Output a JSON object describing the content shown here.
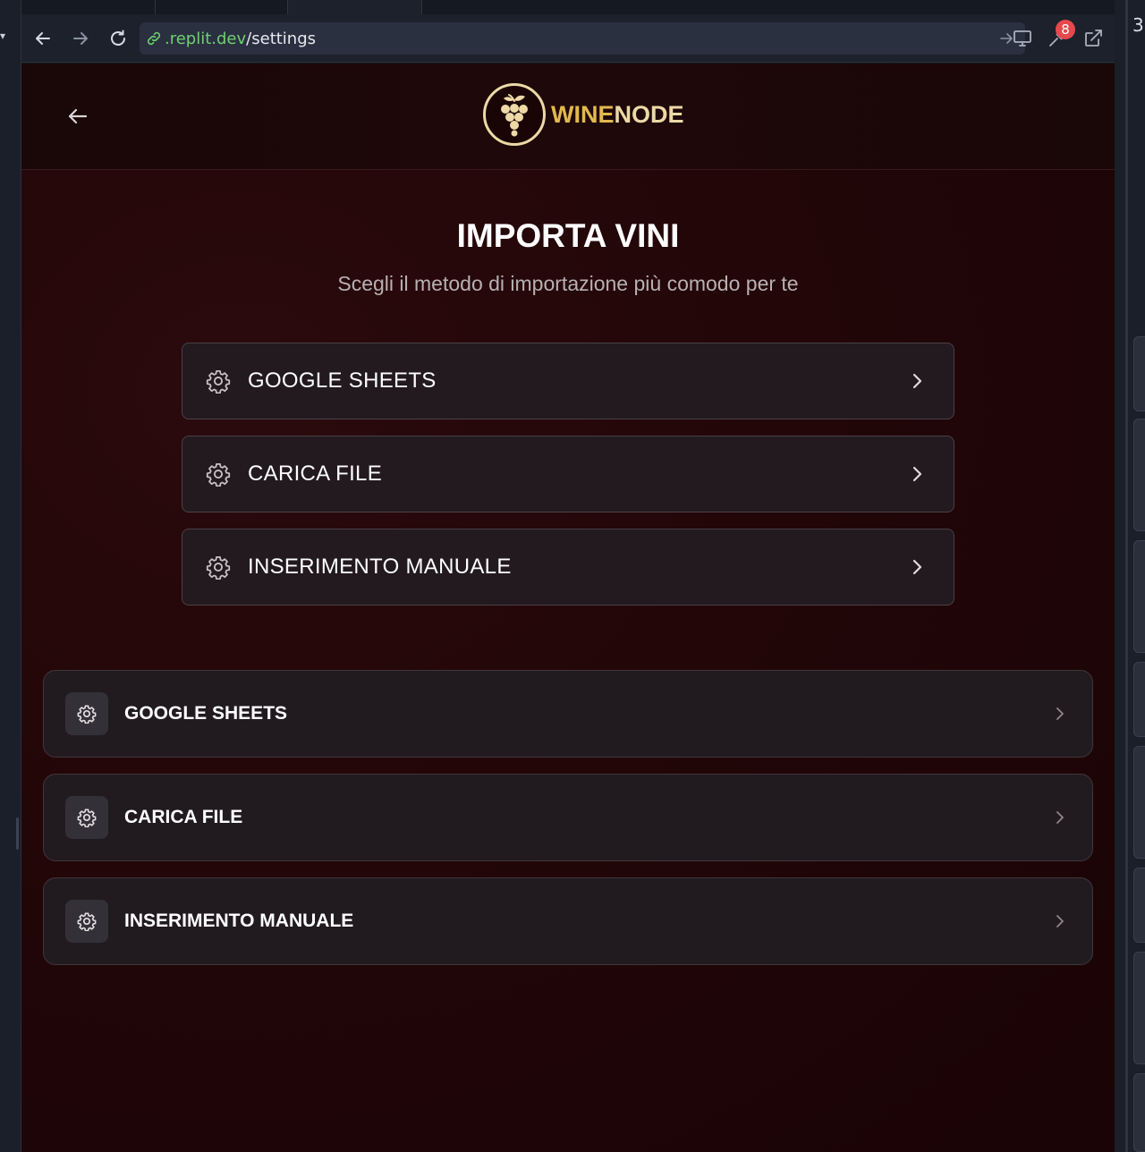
{
  "browser": {
    "url_domain": ".replit.dev",
    "url_path": "/settings",
    "notification_count": "8"
  },
  "side": {
    "right_number": "3"
  },
  "app": {
    "logo": {
      "part1": "WINE",
      "part2": "NODE"
    },
    "title": "IMPORTA VINI",
    "subtitle": "Scegli il metodo di importazione più comodo per te",
    "options_primary": [
      {
        "label": "GOOGLE SHEETS"
      },
      {
        "label": "CARICA FILE"
      },
      {
        "label": "INSERIMENTO MANUALE"
      }
    ],
    "options_secondary": [
      {
        "label": "GOOGLE SHEETS"
      },
      {
        "label": "CARICA FILE"
      },
      {
        "label": "INSERIMENTO MANUALE"
      }
    ]
  },
  "colors": {
    "logo_gold": "#e2b94f",
    "logo_cream": "#ecd9a6",
    "background_wine": "#220608",
    "badge_red": "#e5484d",
    "url_green": "#6fd06f"
  },
  "icons": [
    "back-arrow-icon",
    "forward-arrow-icon",
    "reload-icon",
    "link-icon",
    "go-arrow-icon",
    "monitor-icon",
    "wrench-icon",
    "external-link-icon",
    "grape-logo-icon",
    "gear-icon",
    "chevron-right-icon"
  ]
}
